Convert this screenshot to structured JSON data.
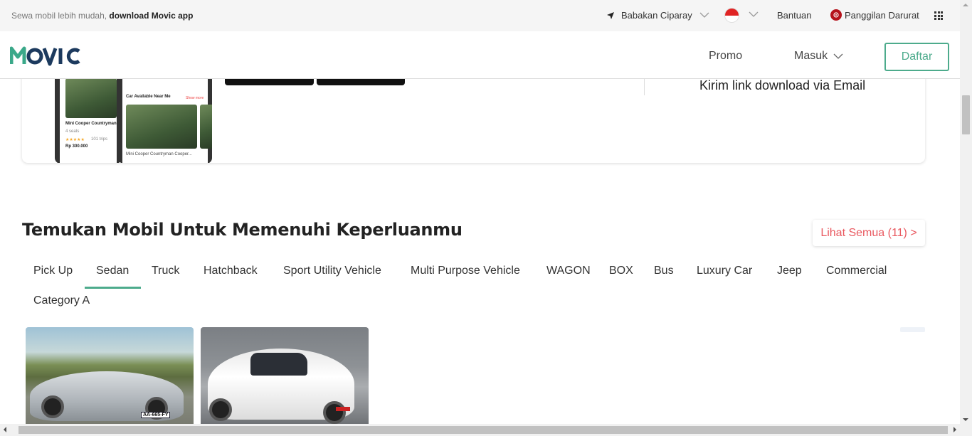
{
  "topbar": {
    "promo_prefix": "Sewa mobil lebih mudah,",
    "promo_link": "download Movic app",
    "location": "Babakan Ciparay",
    "help": "Bantuan",
    "emergency": "Panggilan Darurat"
  },
  "nav": {
    "logo": "MOVIC",
    "promo": "Promo",
    "login": "Masuk",
    "register": "Daftar"
  },
  "download": {
    "email_link": "Kirim link download via Email",
    "phone_screens": {
      "section_label": "Car Available Near Me",
      "show_more": "Show more",
      "car1_name": "Mini Cooper Countryman",
      "car1_seats": "4 seats",
      "car1_trips": "101 trips",
      "car1_price": "Rp 300.000",
      "car2_name": "Mini Cooper Countryman Cooper..."
    }
  },
  "section": {
    "title": "Temukan Mobil Untuk Memenuhi Keperluanmu",
    "see_all": "Lihat Semua (11) >"
  },
  "tabs": [
    "Pick Up",
    "Sedan",
    "Truck",
    "Hatchback",
    "Sport Utility Vehicle",
    "Multi Purpose Vehicle",
    "WAGON",
    "BOX",
    "Bus",
    "Luxury Car",
    "Jeep",
    "Commercial",
    "Category A"
  ],
  "active_tab": "Sedan",
  "cars": {
    "car1_plate": "AA-665-FY"
  },
  "colors": {
    "brand_green": "#4dab8c",
    "brand_navy": "#1c3a5e",
    "accent_red": "#e9585f"
  }
}
